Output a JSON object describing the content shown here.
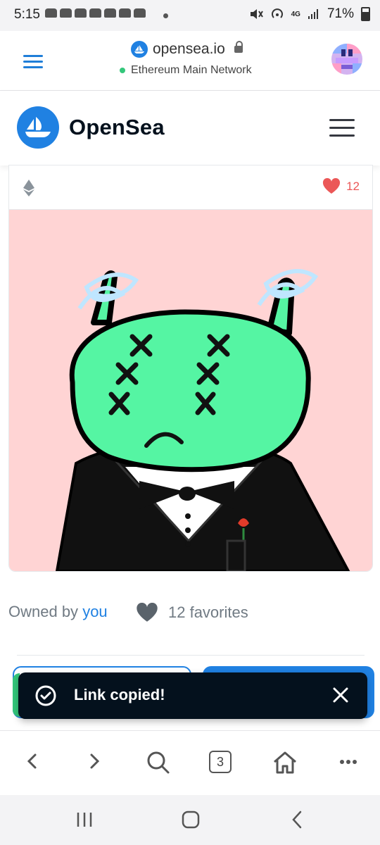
{
  "status_bar": {
    "time": "5:15",
    "network_type": "4G",
    "battery": "71%"
  },
  "browser": {
    "domain": "opensea.io",
    "network_label": "Ethereum Main Network",
    "tab_count": "3"
  },
  "site": {
    "brand": "OpenSea",
    "brand_color": "#2081e2"
  },
  "item": {
    "favorites_count": "12",
    "owned_by_prefix": "Owned by",
    "owner": "you",
    "favorites_label": "12 favorites",
    "background_color": "#ffd4d4",
    "character_color": "#55f5a3"
  },
  "toast": {
    "message": "Link copied!"
  },
  "icons": {
    "menu": "menu-icon",
    "lock": "lock-icon",
    "ethereum": "ethereum-icon",
    "heart": "heart-icon",
    "check": "check-circle-icon",
    "close": "close-icon",
    "back": "back-icon",
    "forward": "forward-icon",
    "search": "search-icon",
    "home": "home-icon",
    "more": "more-icon"
  }
}
